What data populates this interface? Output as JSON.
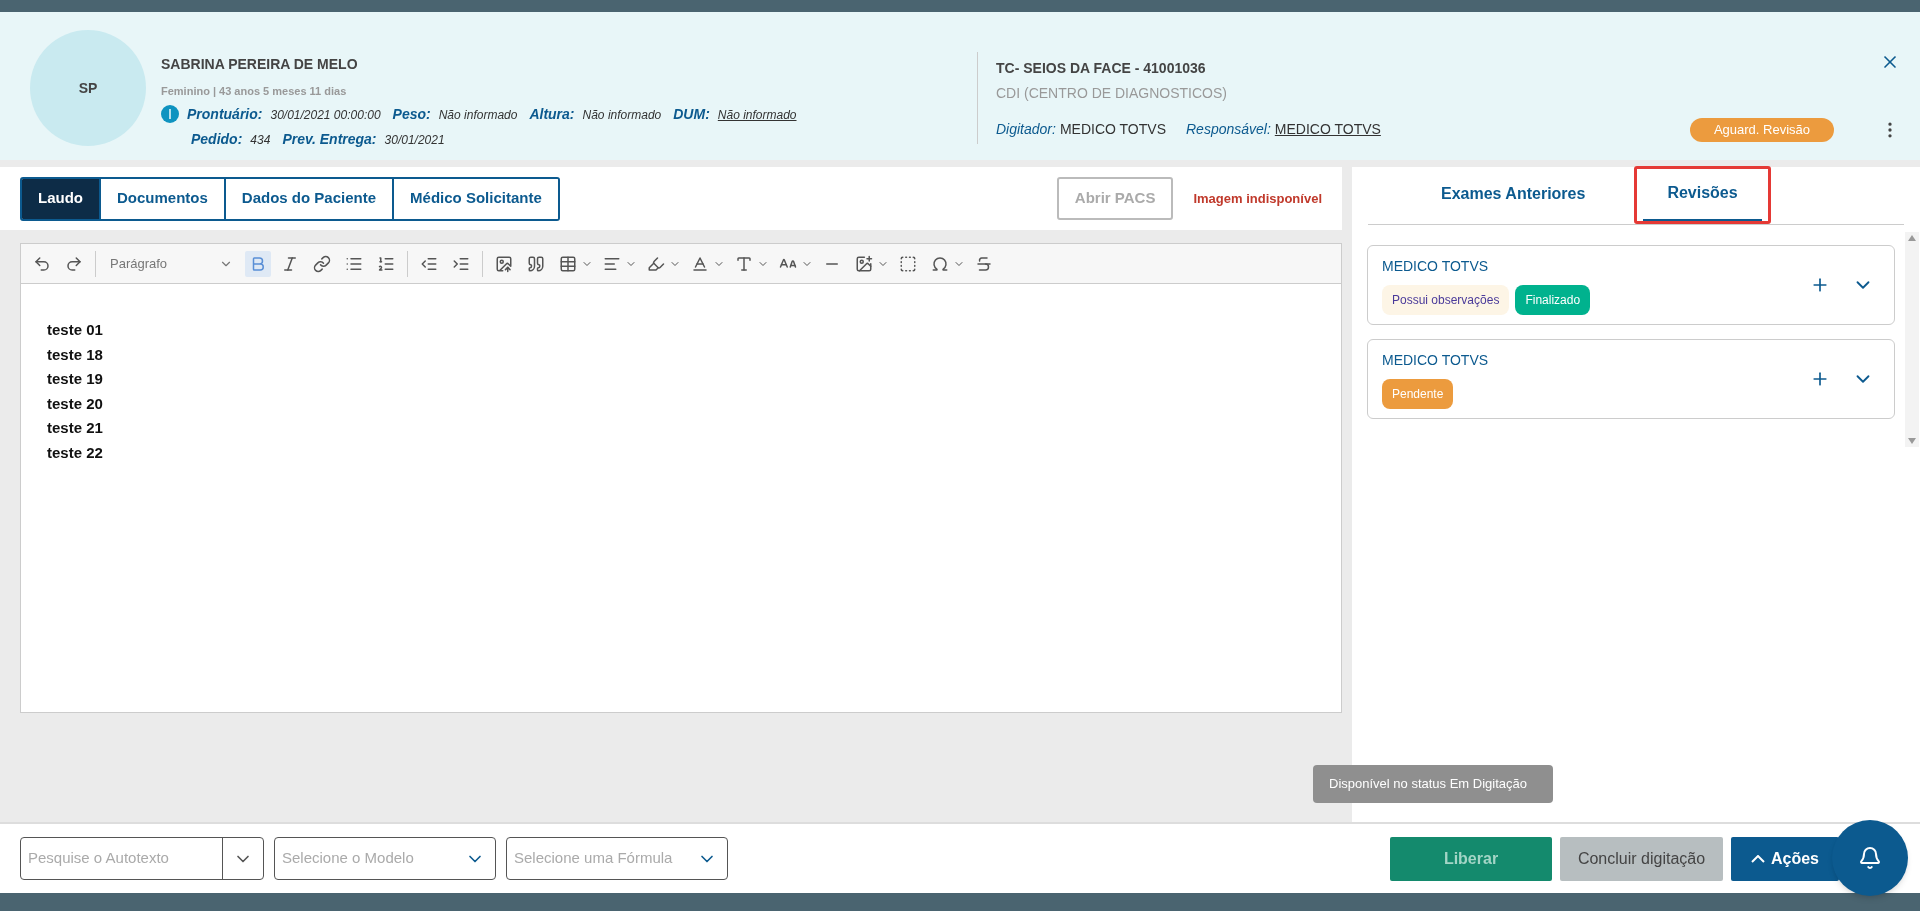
{
  "patient": {
    "initials": "SP",
    "name": "SABRINA PEREIRA DE MELO",
    "subtitle": "Feminino | 43 anos 5 meses 11 dias",
    "fields_row1": [
      {
        "label": "Prontuário:",
        "value": "30/01/2021 00:00:00",
        "link": false
      },
      {
        "label": "Peso:",
        "value": "Não informado",
        "link": false
      },
      {
        "label": "Altura:",
        "value": "Não informado",
        "link": false
      },
      {
        "label": "DUM:",
        "value": "Não informado",
        "link": true
      }
    ],
    "fields_row2": [
      {
        "label": "Pedido:",
        "value": "434",
        "link": false
      },
      {
        "label": "Prev. Entrega:",
        "value": "30/01/2021",
        "link": false
      }
    ]
  },
  "exam": {
    "title": "TC- SEIOS DA FACE - 41001036",
    "unit": "CDI (CENTRO DE DIAGNOSTICOS)",
    "people": [
      {
        "label": "Digitador:",
        "value": "MEDICO TOTVS",
        "link": false
      },
      {
        "label": "Responsável:",
        "value": "MEDICO TOTVS",
        "link": true
      }
    ],
    "status": "Aguard. Revisão"
  },
  "tabs": [
    {
      "label": "Laudo",
      "selected": true
    },
    {
      "label": "Documentos",
      "selected": false
    },
    {
      "label": "Dados do Paciente",
      "selected": false
    },
    {
      "label": "Médico Solicitante",
      "selected": false
    }
  ],
  "pacs_button": {
    "label": "Abrir PACS",
    "disabled": true
  },
  "image_status": "Imagem indisponível",
  "toolbar": {
    "block_format": "Parágrafo",
    "bold_active": true
  },
  "editor_lines": [
    "teste 01",
    "teste 18",
    "teste 19",
    "teste 20",
    "teste 21",
    "teste 22"
  ],
  "side_tabs": [
    {
      "label": "Exames Anteriores",
      "selected": false,
      "highlighted": false
    },
    {
      "label": "Revisões",
      "selected": true,
      "highlighted": true
    }
  ],
  "revisions": [
    {
      "author": "MEDICO TOTVS",
      "tags": [
        {
          "label": "Possui observações",
          "kind": "note"
        },
        {
          "label": "Finalizado",
          "kind": "status",
          "color": "#00b28e"
        }
      ]
    },
    {
      "author": "MEDICO TOTVS",
      "tags": [
        {
          "label": "Pendente",
          "kind": "status",
          "color": "#ec9b3e"
        }
      ]
    }
  ],
  "bottom_fields": [
    {
      "placeholder": "Pesquise o Autotexto",
      "kind": "split"
    },
    {
      "placeholder": "Selecione o Modelo",
      "kind": "plain"
    },
    {
      "placeholder": "Selecione uma Fórmula",
      "kind": "plain"
    }
  ],
  "tooltip": "Disponível no status Em Digitação",
  "actions": [
    {
      "label": "Liberar",
      "kind": "release"
    },
    {
      "label": "Concluir digitação",
      "kind": "secondary"
    },
    {
      "label": "Ações",
      "kind": "primary"
    }
  ]
}
